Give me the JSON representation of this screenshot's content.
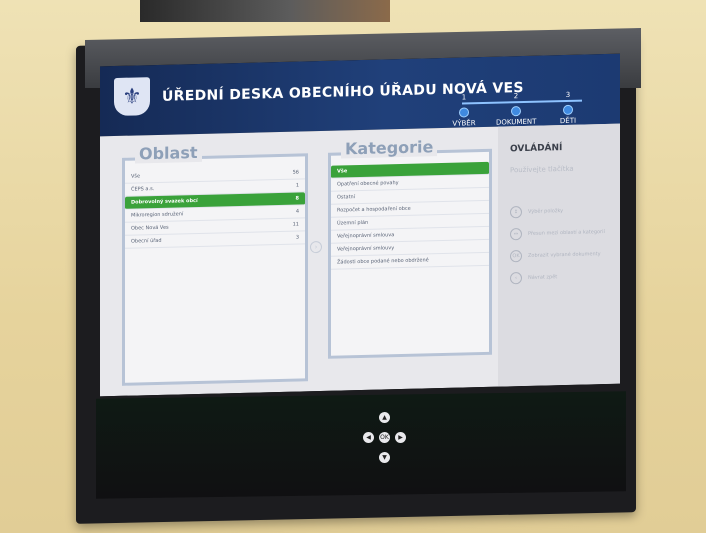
{
  "header": {
    "title": "ÚŘEDNÍ DESKA OBECNÍHO ÚŘADU NOVÁ VES",
    "steps": [
      {
        "num": "1",
        "label": "VÝBĚR"
      },
      {
        "num": "2",
        "label": "DOKUMENT"
      },
      {
        "num": "3",
        "label": "DĚTI"
      }
    ]
  },
  "oblast": {
    "title": "Oblast",
    "rows": [
      {
        "label": "Vše",
        "count": "56"
      },
      {
        "label": "ČEPS a.s.",
        "count": "1"
      },
      {
        "label": "Dobrovolný svazek obcí",
        "count": "8"
      },
      {
        "label": "Mikroregion sdružení",
        "count": "4"
      },
      {
        "label": "Obec Nová Ves",
        "count": "11"
      },
      {
        "label": "Obecní úřad",
        "count": "3"
      }
    ],
    "active_index": 2
  },
  "kategorie": {
    "title": "Kategorie",
    "rows": [
      "Vše",
      "Opatření obecné povahy",
      "Ostatní",
      "Rozpočet a hospodaření obce",
      "Územní plán",
      "Veřejnoprávní smlouva",
      "Veřejnoprávní smlouvy",
      "Žádosti obce podané nebo obdržené"
    ],
    "active_index": 0
  },
  "ovladani": {
    "title": "OVLÁDÁNÍ",
    "subtitle": "Používejte tlačítka",
    "items": [
      {
        "icon": "arrow-up-down-icon",
        "text": "Výběr položky"
      },
      {
        "icon": "arrow-left-right-icon",
        "text": "Přesun mezi oblastí a kategorií"
      },
      {
        "icon": "ok-icon",
        "text": "Zobrazit vybrané dokumenty"
      },
      {
        "icon": "back-icon",
        "text": "Návrat zpět"
      }
    ]
  },
  "keypad": {
    "ok_label": "OK"
  },
  "colors": {
    "header_blue": "#20407a",
    "active_green": "#3aa23a",
    "panel_border": "#b7c3d6"
  }
}
